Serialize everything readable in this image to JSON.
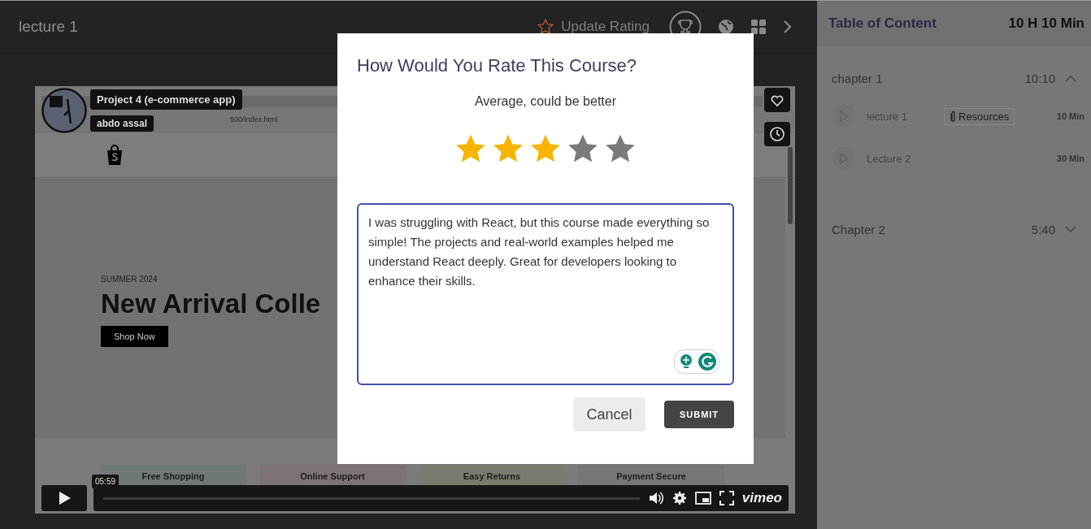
{
  "header": {
    "title": "lecture 1",
    "rating_button": {
      "label": "Update Rating"
    }
  },
  "video": {
    "course_tag": "Project 4 (e-commerce app)",
    "author_tag": "abdo assal",
    "frame": {
      "url": "500/index.html",
      "kicker": "SUMMER 2024",
      "headline": "New Arrival Colle",
      "cta": "Shop Now",
      "features": [
        "Free Shopping",
        "Online Support",
        "Easy Returns",
        "Payment Secure"
      ]
    },
    "time_tooltip": "05:59",
    "player_logo": "vimeo"
  },
  "toc": {
    "title": "Table of Content",
    "total": "10 H 10 Min",
    "chapters": [
      {
        "title": "chapter 1",
        "duration": "10:10",
        "expanded": true,
        "lectures": [
          {
            "title": "lecture 1",
            "resources": "Resources",
            "duration": "10 Min"
          },
          {
            "title": "Lecture 2",
            "duration": "30 Min"
          }
        ]
      },
      {
        "title": "Chapter 2",
        "duration": "5:40",
        "expanded": false
      }
    ]
  },
  "modal": {
    "title": "How Would You Rate This Course?",
    "rating_label": "Average, could be better",
    "stars": 3,
    "review": "I was struggling with React, but this course made everything so simple! The projects and real-world examples helped me understand React deeply. Great for developers looking to enhance their skills.",
    "buttons": [
      {
        "label": "Cancel",
        "kind": "secondary"
      },
      {
        "label": "SUBMIT",
        "kind": "primary"
      }
    ]
  }
}
